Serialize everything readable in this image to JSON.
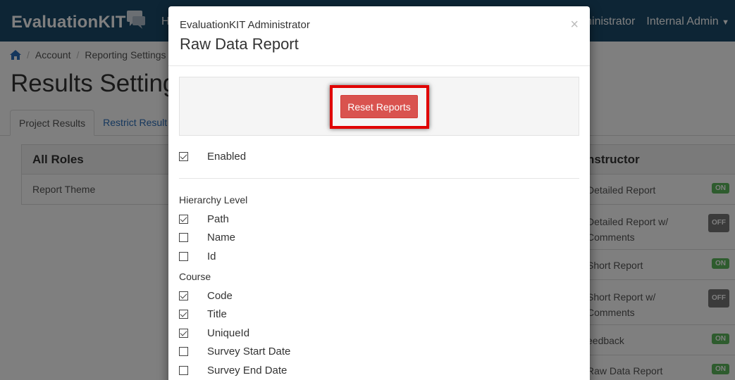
{
  "app": {
    "brand": "EvaluationKIT",
    "nav_partial": "H",
    "nav_right": [
      "ministrator",
      "Internal Admin"
    ]
  },
  "breadcrumb": [
    "Account",
    "Reporting Settings"
  ],
  "page": {
    "title": "Results Settings",
    "tabs": [
      "Project Results",
      "Restrict Result"
    ]
  },
  "left_panel": {
    "title": "All Roles",
    "rows": [
      "Report Theme"
    ]
  },
  "right_panel": {
    "title": "nstructor",
    "rows": [
      {
        "label": "Detailed Report",
        "status": "ON"
      },
      {
        "label": "Detailed Report w/",
        "label2": "Comments",
        "status": "OFF"
      },
      {
        "label": "Short Report",
        "status": "ON"
      },
      {
        "label": "Short Report w/",
        "label2": "Comments",
        "status": "OFF"
      },
      {
        "label": "eedback",
        "status": "ON"
      },
      {
        "label": "Raw Data Report",
        "status": "ON"
      }
    ]
  },
  "modal": {
    "subtitle": "EvaluationKIT Administrator",
    "title": "Raw Data Report",
    "close": "×",
    "reset_button": "Reset Reports",
    "enabled": {
      "label": "Enabled",
      "checked": true
    },
    "hierarchy": {
      "label": "Hierarchy Level",
      "options": [
        {
          "label": "Path",
          "checked": true
        },
        {
          "label": "Name",
          "checked": false
        },
        {
          "label": "Id",
          "checked": false
        }
      ]
    },
    "course": {
      "label": "Course",
      "options": [
        {
          "label": "Code",
          "checked": true
        },
        {
          "label": "Title",
          "checked": true
        },
        {
          "label": "UniqueId",
          "checked": true
        },
        {
          "label": "Survey Start Date",
          "checked": false
        },
        {
          "label": "Survey End Date",
          "checked": false
        }
      ]
    }
  },
  "colors": {
    "navbar": "#1b4a6b",
    "danger": "#d9534f",
    "highlight": "#e00000",
    "on": "#5cb85c",
    "off": "#777777"
  }
}
